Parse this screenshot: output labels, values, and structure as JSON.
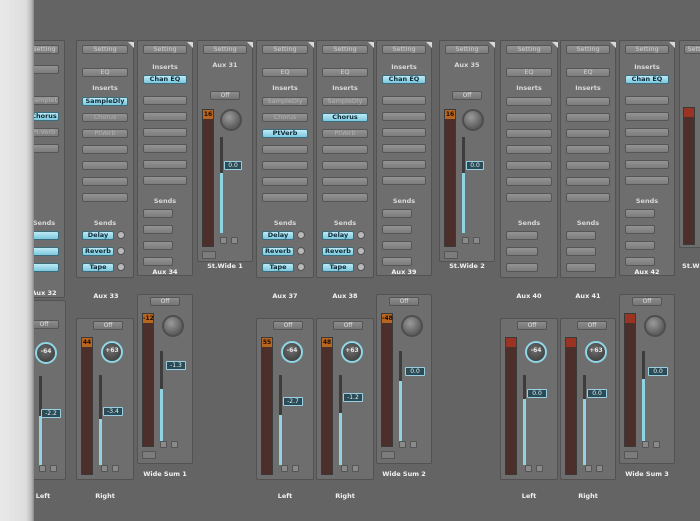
{
  "labels": {
    "setting": "Setting",
    "eq": "EQ",
    "inserts": "Inserts",
    "sends": "Sends",
    "off": "Off"
  },
  "top_strips": [
    {
      "name": "",
      "inserts": [
        "",
        "SampleDly",
        "Chorus",
        "Pi.Verb"
      ],
      "sends": [
        "",
        "",
        ""
      ]
    },
    {
      "name": "Aux 33",
      "inserts": [
        "SampleDly",
        "Chorus",
        "PtVerb"
      ],
      "sends": [
        "Delay",
        "Reverb",
        "Tape"
      ]
    },
    {
      "name": "Aux 34",
      "inserts": [
        "Chan EQ"
      ],
      "sends": []
    },
    {
      "name": "St.Wide 1",
      "aux_label": "Aux 31",
      "peak": "16",
      "readout": "0.0"
    },
    {
      "name": "Aux 37",
      "inserts": [
        "",
        "",
        "PtVerb"
      ],
      "sends": [
        "Delay",
        "Reverb",
        "Tape"
      ]
    },
    {
      "name": "Aux 38",
      "inserts": [
        "",
        "Chorus",
        "PtVerb"
      ],
      "sends": [
        "Delay",
        "Reverb",
        "Tape"
      ]
    },
    {
      "name": "Aux 39",
      "inserts": [
        "Chan EQ"
      ],
      "sends": []
    },
    {
      "name": "St.Wide 2",
      "aux_label": "Aux 35",
      "peak": "16",
      "readout": "0.0"
    },
    {
      "name": "Aux 40",
      "inserts": [],
      "sends": []
    },
    {
      "name": "Aux 41",
      "inserts": [],
      "sends": []
    },
    {
      "name": "Aux 42",
      "inserts": [
        "Chan EQ"
      ],
      "sends": []
    },
    {
      "name": "St.Wi"
    }
  ],
  "bottom_strips": [
    {
      "name": "Left",
      "pan": "-64",
      "readout": "-2.2"
    },
    {
      "name": "Right",
      "pan": "+63",
      "readout": "-3.4",
      "peak": "44"
    },
    {
      "name": "Wide Sum 1",
      "readout": "-1.3",
      "peak": "-12"
    },
    {
      "name": "Left",
      "pan": "-64",
      "readout": "-2.7",
      "peak": "55"
    },
    {
      "name": "Right",
      "pan": "+63",
      "readout": "-1.2",
      "peak": "48"
    },
    {
      "name": "Wide Sum 2",
      "readout": "0.0",
      "peak": "-48"
    },
    {
      "name": "Left",
      "pan": "-64",
      "readout": "0.0"
    },
    {
      "name": "Right",
      "pan": "+63",
      "readout": "0.0"
    },
    {
      "name": "Wide Sum 3",
      "readout": "0.0"
    }
  ],
  "partial_labels": {
    "aux32": "Aux 32"
  }
}
